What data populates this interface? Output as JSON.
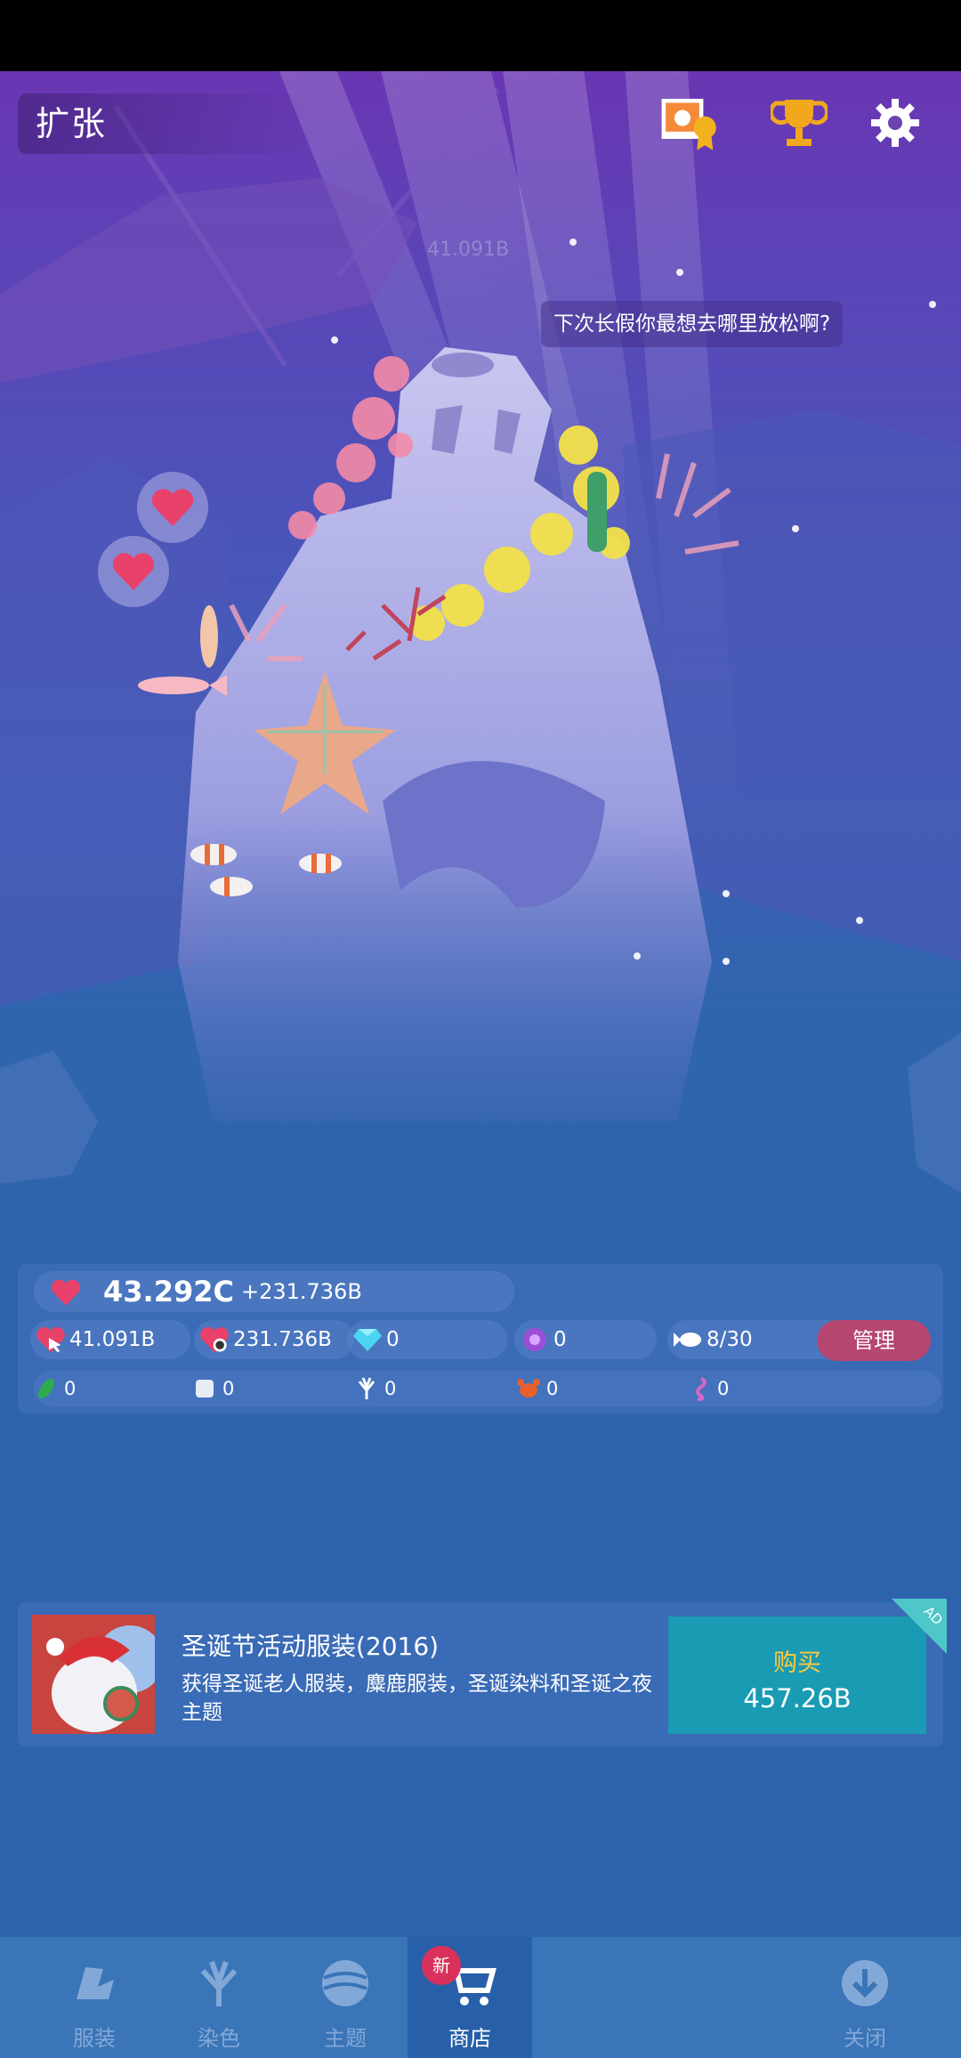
{
  "top": {
    "title": "扩张",
    "photo_icon": "photo-award-icon",
    "trophy_icon": "trophy-icon",
    "settings_icon": "gear-icon"
  },
  "scene": {
    "faint_number": "41.091B",
    "speech_bubble": "下次长假你最想去哪里放松啊?"
  },
  "stats": {
    "main_value": "43.292C",
    "main_delta": "+231.736B",
    "tap_value": "41.091B",
    "idle_value": "231.736B",
    "gems": "0",
    "pearls": "0",
    "fish_count": "8/30",
    "manage_label": "管理",
    "items": [
      {
        "icon": "seaweed-icon",
        "value": "0"
      },
      {
        "icon": "shell-icon",
        "value": "0"
      },
      {
        "icon": "coral-icon",
        "value": "0"
      },
      {
        "icon": "crab-icon",
        "value": "0"
      },
      {
        "icon": "seahorse-icon",
        "value": "0"
      }
    ]
  },
  "offer": {
    "title": "圣诞节活动服装(2016)",
    "description": "获得圣诞老人服装，麋鹿服装，圣诞染料和圣诞之夜主题",
    "buy_label": "购买",
    "price": "457.26B",
    "ad_tag": "AD"
  },
  "nav": {
    "costume": "服装",
    "dye": "染色",
    "theme": "主题",
    "shop": "商店",
    "shop_badge": "新",
    "close": "关闭"
  },
  "colors": {
    "manage_button": "#b54670",
    "buy_button": "#1a9bb4",
    "buy_text": "#ffc93b",
    "heart": "#e8416a"
  }
}
